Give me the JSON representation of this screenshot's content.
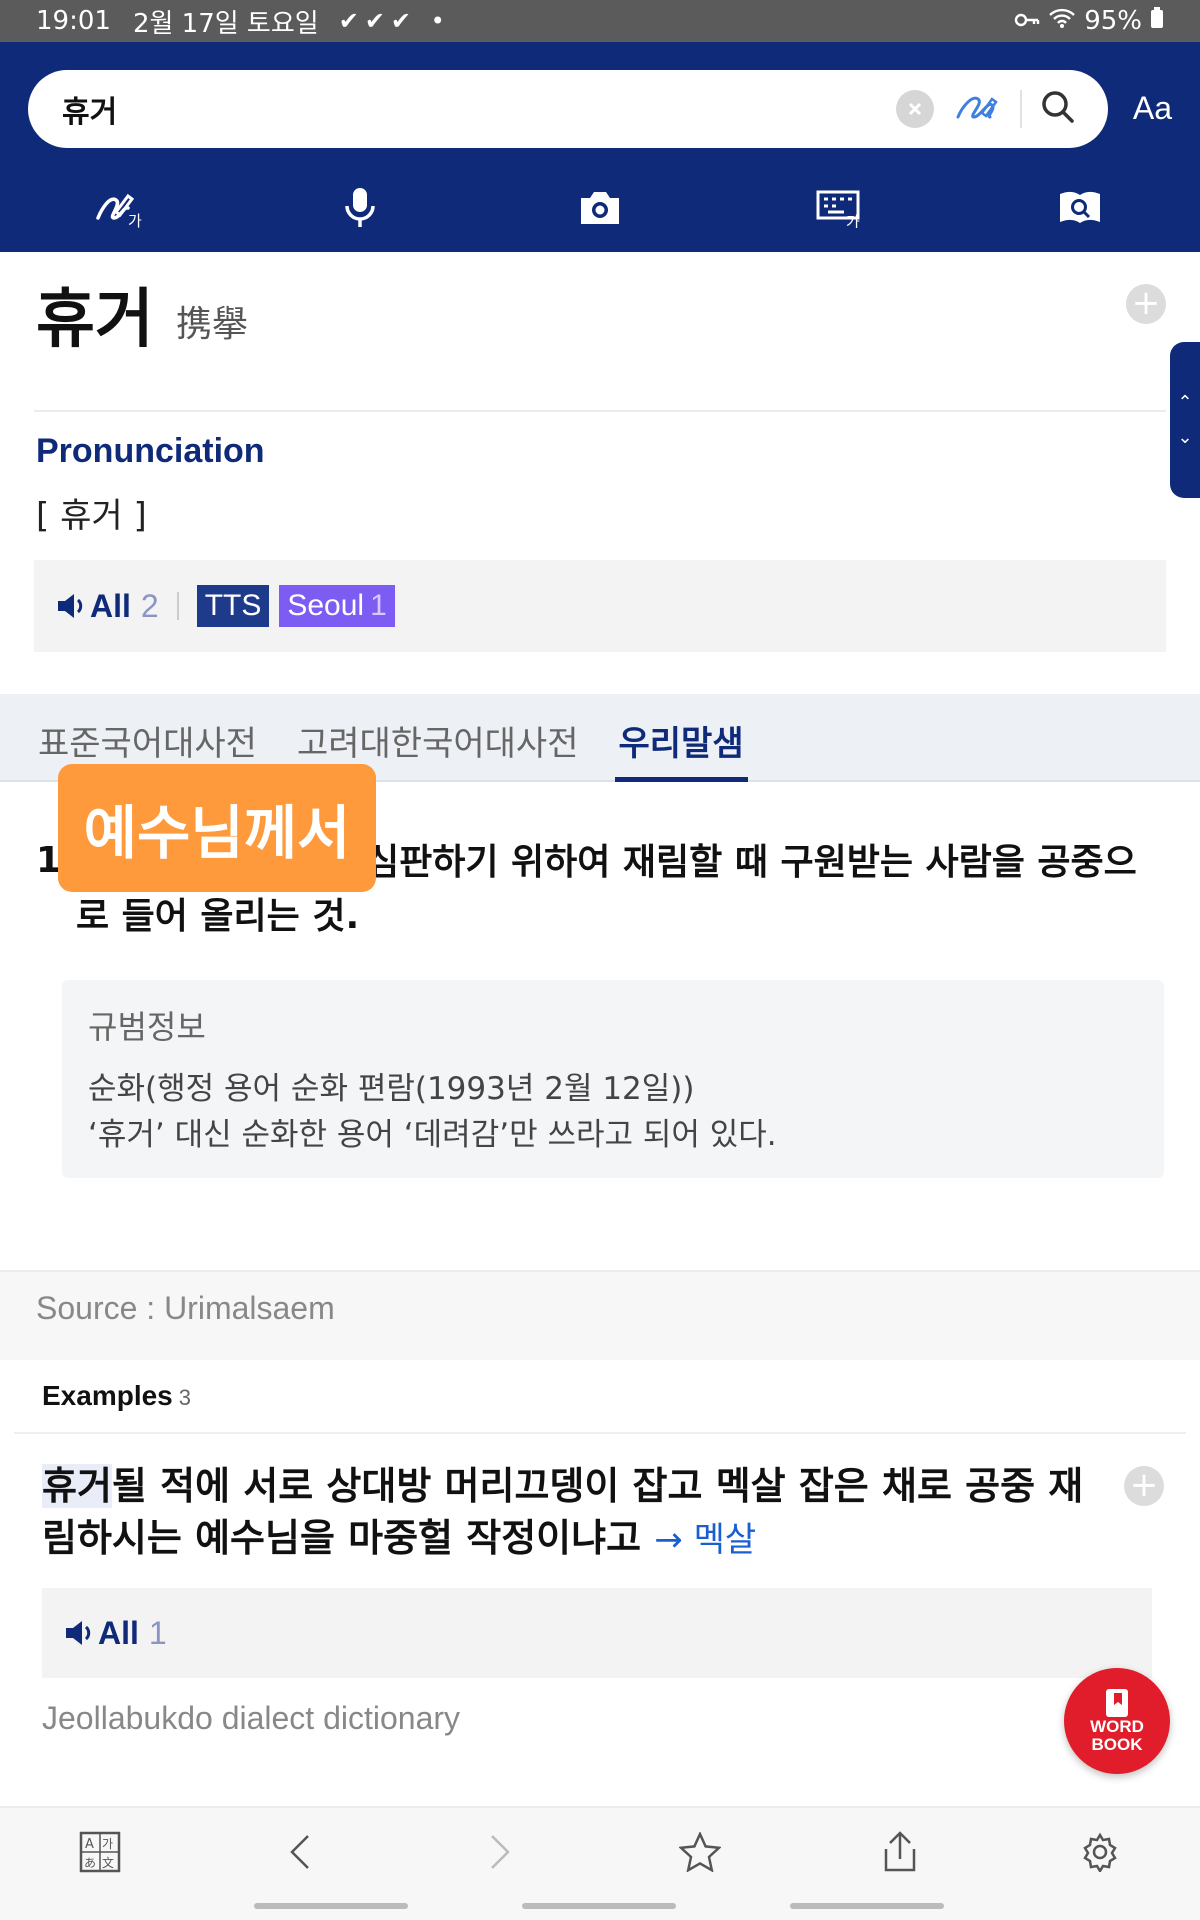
{
  "status": {
    "time": "19:01",
    "date": "2월 17일 토요일",
    "checks": "✔✔✔ •",
    "battery": "95%"
  },
  "search": {
    "query": "휴거",
    "font_button": "Aa"
  },
  "tools": [
    "handwriting-input",
    "voice-input",
    "camera-search",
    "keyboard-input",
    "dictionary-book"
  ],
  "entry": {
    "headword": "휴거",
    "hanja": "携擧"
  },
  "pronunciation": {
    "title": "Pronunciation",
    "text": "[ 휴거 ]",
    "audio_all_label": "All",
    "audio_all_count": "2",
    "tts_label": "TTS",
    "seoul_label": "Seoul",
    "seoul_count": "1"
  },
  "tabs": [
    {
      "label": "표준국어대사전",
      "active": false
    },
    {
      "label": "고려대한국어대사전",
      "active": false
    },
    {
      "label": "우리말샘",
      "active": true
    }
  ],
  "definition": {
    "number": "1",
    "text": "예수님께서 세상을 심판하기 위하여 재림할 때 구원받는 사람을 공중으로 들어 올리는 것.",
    "overlay_label": "예수님께서"
  },
  "norm_info": {
    "title": "규범정보",
    "line1": "순화(행정 용어 순화 편람(1993년 2월 12일))",
    "line2": "‘휴거’ 대신 순화한 용어 ‘데려감’만 쓰라고 되어 있다."
  },
  "source": "Source : Urimalsaem",
  "examples": {
    "header": "Examples",
    "count": "3",
    "highlight": "휴거",
    "sentence_rest": "될 적에 서로 상대방 머리끄뎅이 잡고 멕살 잡은 채로 공중 재림하시는 예수님을 마중헐 작정이냐고",
    "link": "→ 멕살",
    "audio_all_label": "All",
    "audio_all_count": "1",
    "source": "Jeollabukdo dialect dictionary"
  },
  "wordbook": {
    "line1": "WORD",
    "line2": "BOOK"
  },
  "bottom_nav": [
    "translate",
    "back",
    "forward",
    "favorite",
    "share",
    "settings"
  ],
  "colors": {
    "header_bg": "#0e2a78",
    "accent_orange": "#ff9a3c",
    "seoul_purple": "#7c5cf2",
    "wordbook_red": "#e11d2b",
    "link_blue": "#1a5fd0"
  }
}
